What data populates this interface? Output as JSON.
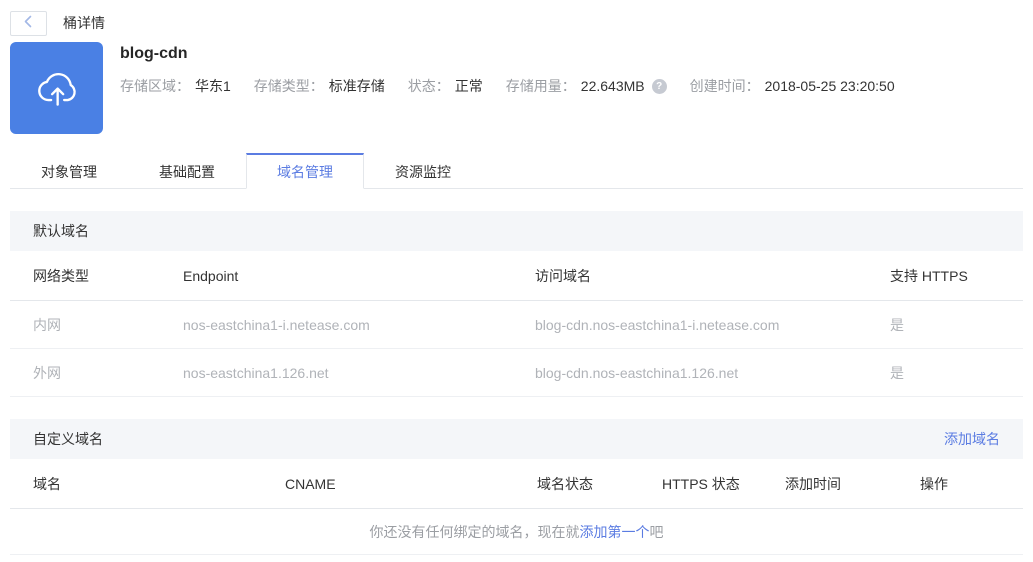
{
  "colors": {
    "accent": "#4a80e4",
    "link": "#5b7ce2",
    "section_bg": "#f4f6f9"
  },
  "icons": {
    "back": "chevron-left",
    "bucket": "cloud-upload",
    "help": "question-mark-circle"
  },
  "header": {
    "title": "桶详情"
  },
  "bucket": {
    "name": "blog-cdn",
    "info": [
      {
        "label": "存储区域：",
        "value": "华东1"
      },
      {
        "label": "存储类型：",
        "value": "标准存储"
      },
      {
        "label": "状态：",
        "value": "正常"
      },
      {
        "label": "存储用量：",
        "value": "22.643MB"
      },
      {
        "label": "创建时间：",
        "value": "2018-05-25 23:20:50"
      }
    ]
  },
  "tabs": [
    {
      "label": "对象管理",
      "active": false
    },
    {
      "label": "基础配置",
      "active": false
    },
    {
      "label": "域名管理",
      "active": true
    },
    {
      "label": "资源监控",
      "active": false
    }
  ],
  "default_domains": {
    "section_title": "默认域名",
    "columns": [
      "网络类型",
      "Endpoint",
      "访问域名",
      "支持 HTTPS"
    ],
    "rows": [
      [
        "内网",
        "nos-eastchina1-i.netease.com",
        "blog-cdn.nos-eastchina1-i.netease.com",
        "是"
      ],
      [
        "外网",
        "nos-eastchina1.126.net",
        "blog-cdn.nos-eastchina1.126.net",
        "是"
      ]
    ]
  },
  "custom_domains": {
    "section_title": "自定义域名",
    "add_link": "添加域名",
    "columns": [
      "域名",
      "CNAME",
      "域名状态",
      "HTTPS 状态",
      "添加时间",
      "操作"
    ],
    "empty": {
      "prefix": "你还没有任何绑定的域名，现在就",
      "link": "添加第一个",
      "suffix": "吧"
    }
  }
}
